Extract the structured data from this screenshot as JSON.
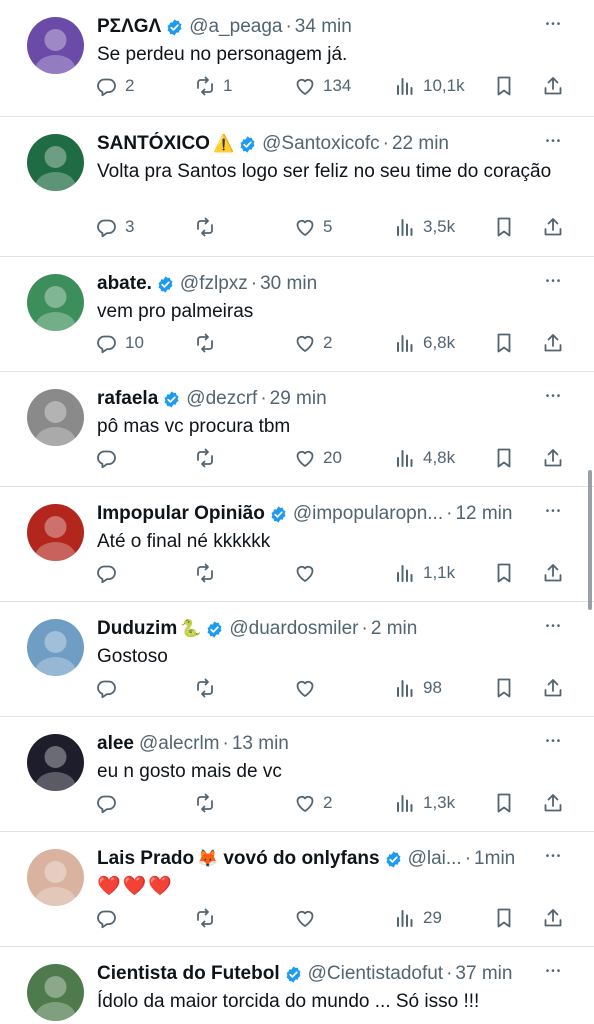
{
  "scrollbar": {
    "position": 0.47
  },
  "tweets": [
    {
      "name": "ΡΣΛGΛ",
      "name_emoji": "",
      "verified": true,
      "handle": "@a_peaga",
      "time": "34 min",
      "text": "Se perdeu no personagem já.",
      "reply": "2",
      "retweet": "1",
      "like": "134",
      "views": "10,1k",
      "avatar_color": "#6a4ba8"
    },
    {
      "name": "SANTÓXICO",
      "name_emoji": "⚠️",
      "verified": true,
      "handle": "@Santoxicofc",
      "time": "22 min",
      "text": "Volta pra Santos logo ser feliz no seu time do coração",
      "reply": "3",
      "retweet": "",
      "like": "5",
      "views": "3,5k",
      "avatar_color": "#1f6b43"
    },
    {
      "name": "abate.",
      "name_emoji": "",
      "verified": true,
      "handle": "@fzlpxz",
      "time": "30 min",
      "text": "vem pro palmeiras",
      "reply": "10",
      "retweet": "",
      "like": "2",
      "views": "6,8k",
      "avatar_color": "#3c8f5a"
    },
    {
      "name": "rafaela",
      "name_emoji": "",
      "verified": true,
      "handle": "@dezcrf",
      "time": "29 min",
      "text": "pô mas vc procura tbm",
      "reply": "",
      "retweet": "",
      "like": "20",
      "views": "4,8k",
      "avatar_color": "#8a8a8a"
    },
    {
      "name": "Impopular Opinião",
      "name_emoji": "",
      "verified": true,
      "handle": "@impopularopn...",
      "time": "12 min",
      "text": "Até o final né kkkkkk",
      "reply": "",
      "retweet": "",
      "like": "",
      "views": "1,1k",
      "avatar_color": "#b3261e"
    },
    {
      "name": "Duduzim",
      "name_emoji": "🐍",
      "verified": true,
      "handle": "@duardosmiler",
      "time": "2 min",
      "text": "Gostoso",
      "reply": "",
      "retweet": "",
      "like": "",
      "views": "98",
      "avatar_color": "#6f9dc4"
    },
    {
      "name": "alee",
      "name_emoji": "",
      "verified": false,
      "handle": "@alecrlm",
      "time": "13 min",
      "text": "eu n gosto mais de vc",
      "reply": "",
      "retweet": "",
      "like": "2",
      "views": "1,3k",
      "avatar_color": "#1d1d2b"
    },
    {
      "name": "Lais Prado",
      "name_emoji": "🦊",
      "name_suffix": "vovó do onlyfans",
      "verified": true,
      "handle": "@lai...",
      "time": "1min",
      "text": "❤️❤️❤️",
      "reply": "",
      "retweet": "",
      "like": "",
      "views": "29",
      "avatar_color": "#d9b3a0"
    },
    {
      "name": "Cientista do Futebol",
      "name_emoji": "",
      "verified": true,
      "handle": "@Cientistadofut",
      "time": "37 min",
      "text": "Ídolo da maior torcida do mundo ... Só isso  !!!",
      "reply": "",
      "retweet": "",
      "like": "",
      "views": "",
      "avatar_color": "#4e7a4e"
    }
  ]
}
